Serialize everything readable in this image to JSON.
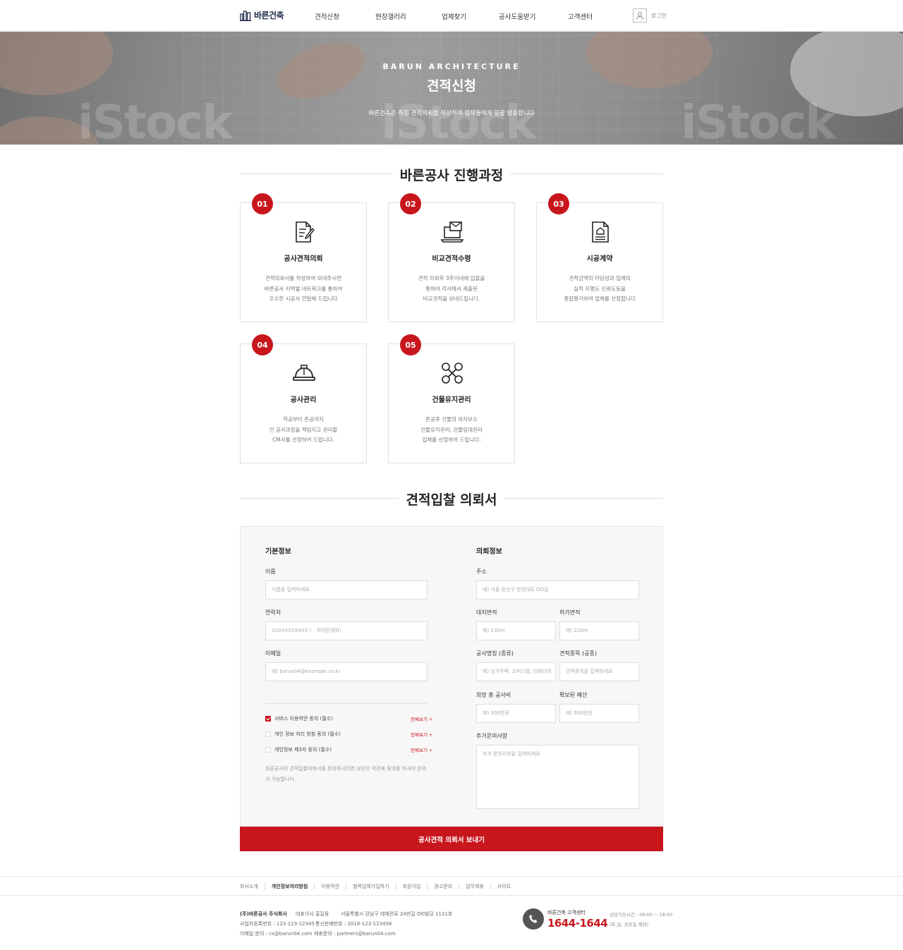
{
  "header": {
    "logo_text": "바른건축",
    "nav": [
      "견적신청",
      "현장갤러리",
      "업체찾기",
      "공사도움받기",
      "고객센터"
    ],
    "login_label": "로그인"
  },
  "hero": {
    "subtitle": "BARUN ARCHITECTURE",
    "title": "견적신청",
    "description": "바른건축은 직접 견적의뢰를 작성하여 업체들에게 일괄 발송합니다",
    "watermark": "iStock"
  },
  "process": {
    "title": "바른공사 진행과정",
    "steps": [
      {
        "num": "01",
        "icon": "document-edit-icon",
        "title": "공사견적의뢰",
        "desc": [
          "견적의뢰서를 작성하여 보내주시면",
          "바른공사 지역별 네트워크를 통하여",
          "우수한 시공사 전달해 드립니다"
        ]
      },
      {
        "num": "02",
        "icon": "laptop-mail-icon",
        "title": "비교견적수령",
        "desc": [
          "견적 의뢰후 3주이내에 입찰을",
          "통하여 각사에서 제출된",
          "비교견적을 보내드립니다."
        ]
      },
      {
        "num": "03",
        "icon": "contract-icon",
        "title": "시공계약",
        "desc": [
          "견적금액의 타당성과 업체의",
          "실적 지명도 신뢰도등을",
          "종합평가하여 업체를 선정합니다"
        ]
      },
      {
        "num": "04",
        "icon": "hard-hat-icon",
        "title": "공사관리",
        "desc": [
          "착공부터 준공까지",
          "전 공사과정을 책임지고 관리할",
          "CM사를 선정하여 드립니다."
        ]
      },
      {
        "num": "05",
        "icon": "tools-icon",
        "title": "건물유지관리",
        "desc": [
          "준공후 건물의 하자보수",
          "건물유지관리, 건물임대관리",
          "업체를 선정하여 드립니다."
        ]
      }
    ]
  },
  "request": {
    "title": "견적입찰 의뢰서",
    "basic": {
      "heading": "기본정보",
      "name_label": "이름",
      "name_placeholder": "이름을 입력하세요.",
      "phone_label": "연락처",
      "phone_placeholder": "010XXXXXXXX ( - 하이픈제외)",
      "email_label": "이메일",
      "email_placeholder": "예) barun04@example.co.kr"
    },
    "detail": {
      "heading": "의뢰정보",
      "address_label": "주소",
      "address_placeholder": "예) 서울 용산구 한강대로 OO길",
      "site_area_label": "대지면적",
      "site_area_placeholder": "예) 130m",
      "permit_area_label": "허가면적",
      "permit_area_placeholder": "예) 220m",
      "work_type_label": "공사명칭 (종류)",
      "work_type_placeholder": "예) 상가주택, 오피스텔, 인테리어",
      "estimate_item_label": "견적종목 (공종)",
      "estimate_item_placeholder": "견적종목을 입력하세요",
      "desired_cost_label": "희망 총 공사비",
      "desired_cost_placeholder": "예) 300만원",
      "budget_label": "확보된 예산",
      "budget_placeholder": "예) 500만원",
      "extra_label": "추가문의사항",
      "extra_placeholder": "추가 문의사항을 입력하세요."
    },
    "agreements": [
      {
        "label": "서비스 이용약관 동의 (필수)",
        "checked": true,
        "more": "전체보기 +"
      },
      {
        "label": "개인 정보 처리 방침 동의 (필수)",
        "checked": false,
        "more": "전체보기 +"
      },
      {
        "label": "개인정보 제3자 동의 (필수)",
        "checked": false,
        "more": "전체보기 +"
      }
    ],
    "note": "바른공사의 견적입찰의뢰서를 문의하시려면 상단의 약관에 동의를 하셔야 문의가 가능합니다.",
    "submit_label": "공사견적 의뢰서 보내기"
  },
  "footer": {
    "links": [
      "회사소개",
      "개인정보처리방침",
      "이용약관",
      "협력업체가입하기",
      "회원가입",
      "광고문의",
      "업무제휴",
      "사이트"
    ],
    "company": "(주)바른공사 주식회사",
    "ceo": "대표이사 홍길동",
    "address": "서울특별시 강남구 테헤란로 24번길 OO빌딩 1111호",
    "biz_no": "사업자등록번호 : 123-123-12345",
    "ecommerce_no": "통신판매번호 : 2018-123-123456",
    "email": "이메일 문의 : cs@barun04.com",
    "partner_email": "제휴문의 : partners@barun04.com",
    "cs_label": "바른건축 고객센터",
    "cs_phone": "1644-1644",
    "hours": "상담가능시간 : 09:00 ~ 18:00",
    "holiday": "(토,일, 공휴일 제외)"
  },
  "colors": {
    "accent": "#c8161d",
    "brand": "#1e2a4a"
  }
}
